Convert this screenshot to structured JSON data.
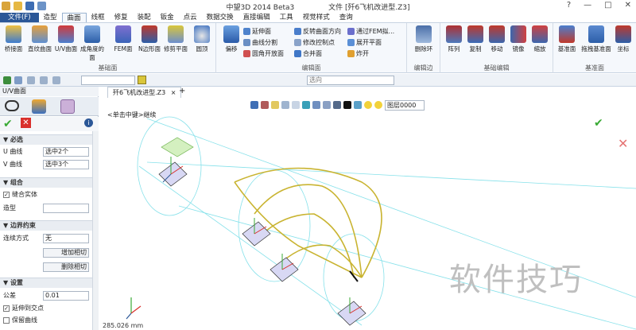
{
  "app": {
    "title": "中望3D 2014 Beta3",
    "doc_label": "文件 [歼6飞机改进型.Z3]"
  },
  "window_controls": [
    "?",
    "—",
    "□",
    "✕"
  ],
  "menu": [
    "文件(F)",
    "造型",
    "曲面",
    "线框",
    "修复",
    "装配",
    "钣金",
    "点云",
    "数据交换",
    "直接编辑",
    "工具",
    "视觉样式",
    "查询"
  ],
  "ribbon": {
    "surface_group": {
      "label": "基础面",
      "buttons": [
        "桥接面",
        "直纹曲面",
        "U/V曲面",
        "成角度的面",
        "FEM面",
        "N边形面",
        "修剪平面",
        "圆顶"
      ]
    },
    "edit_group": {
      "label": "编辑面",
      "big": "偏移",
      "small": [
        "延伸面",
        "曲线分割",
        "圆角开放面",
        "反转曲面方向",
        "修改控制点",
        "合并面",
        "通过FEM拟...",
        "展开平面",
        "炸开"
      ]
    },
    "edge_group": {
      "label": "编辑边",
      "buttons": [
        "删除环"
      ]
    },
    "basic_edit_group": {
      "label": "基础编辑",
      "buttons": [
        "阵列",
        "复制",
        "移动",
        "镜像",
        "缩放"
      ]
    },
    "datum_group": {
      "label": "基准面",
      "buttons": [
        "基准面",
        "拖拽基准面",
        "坐标"
      ]
    }
  },
  "toolbar2": {
    "filter_label": "全部",
    "view_select": "",
    "mode_select": "选向"
  },
  "panel": {
    "title": "U/V曲面",
    "required": {
      "header": "必选",
      "u_label": "U 曲线",
      "u_value": "选中2个",
      "v_label": "V 曲线",
      "v_value": "选中3个"
    },
    "combine": {
      "header": "组合",
      "sew_label": "缝合实体",
      "sew_checked": true,
      "shape_label": "造型",
      "shape_value": ""
    },
    "boundary": {
      "header": "边界约束",
      "mode_label": "连续方式",
      "mode_value": "无",
      "btn1": "增加相切",
      "btn2": "删除相切"
    },
    "settings": {
      "header": "设置",
      "tol_label": "公差",
      "tol_value": "0.01",
      "extend_label": "延伸到交点",
      "extend_checked": true,
      "keep_label": "保留曲线",
      "keep_checked": false
    }
  },
  "viewport": {
    "doc_tab": "歼6飞机改进型.Z3",
    "layer": "图层0000",
    "prompt": "<单击中键>继续",
    "coordinate": "285.026 mm"
  },
  "watermark": "软件技巧",
  "colors": {
    "accent": "#2b5797",
    "curve_yellow": "#c9b431",
    "circle_cyan": "#7fe0e8",
    "ok_green": "#3aaa35",
    "cancel_red": "#d9302c"
  }
}
